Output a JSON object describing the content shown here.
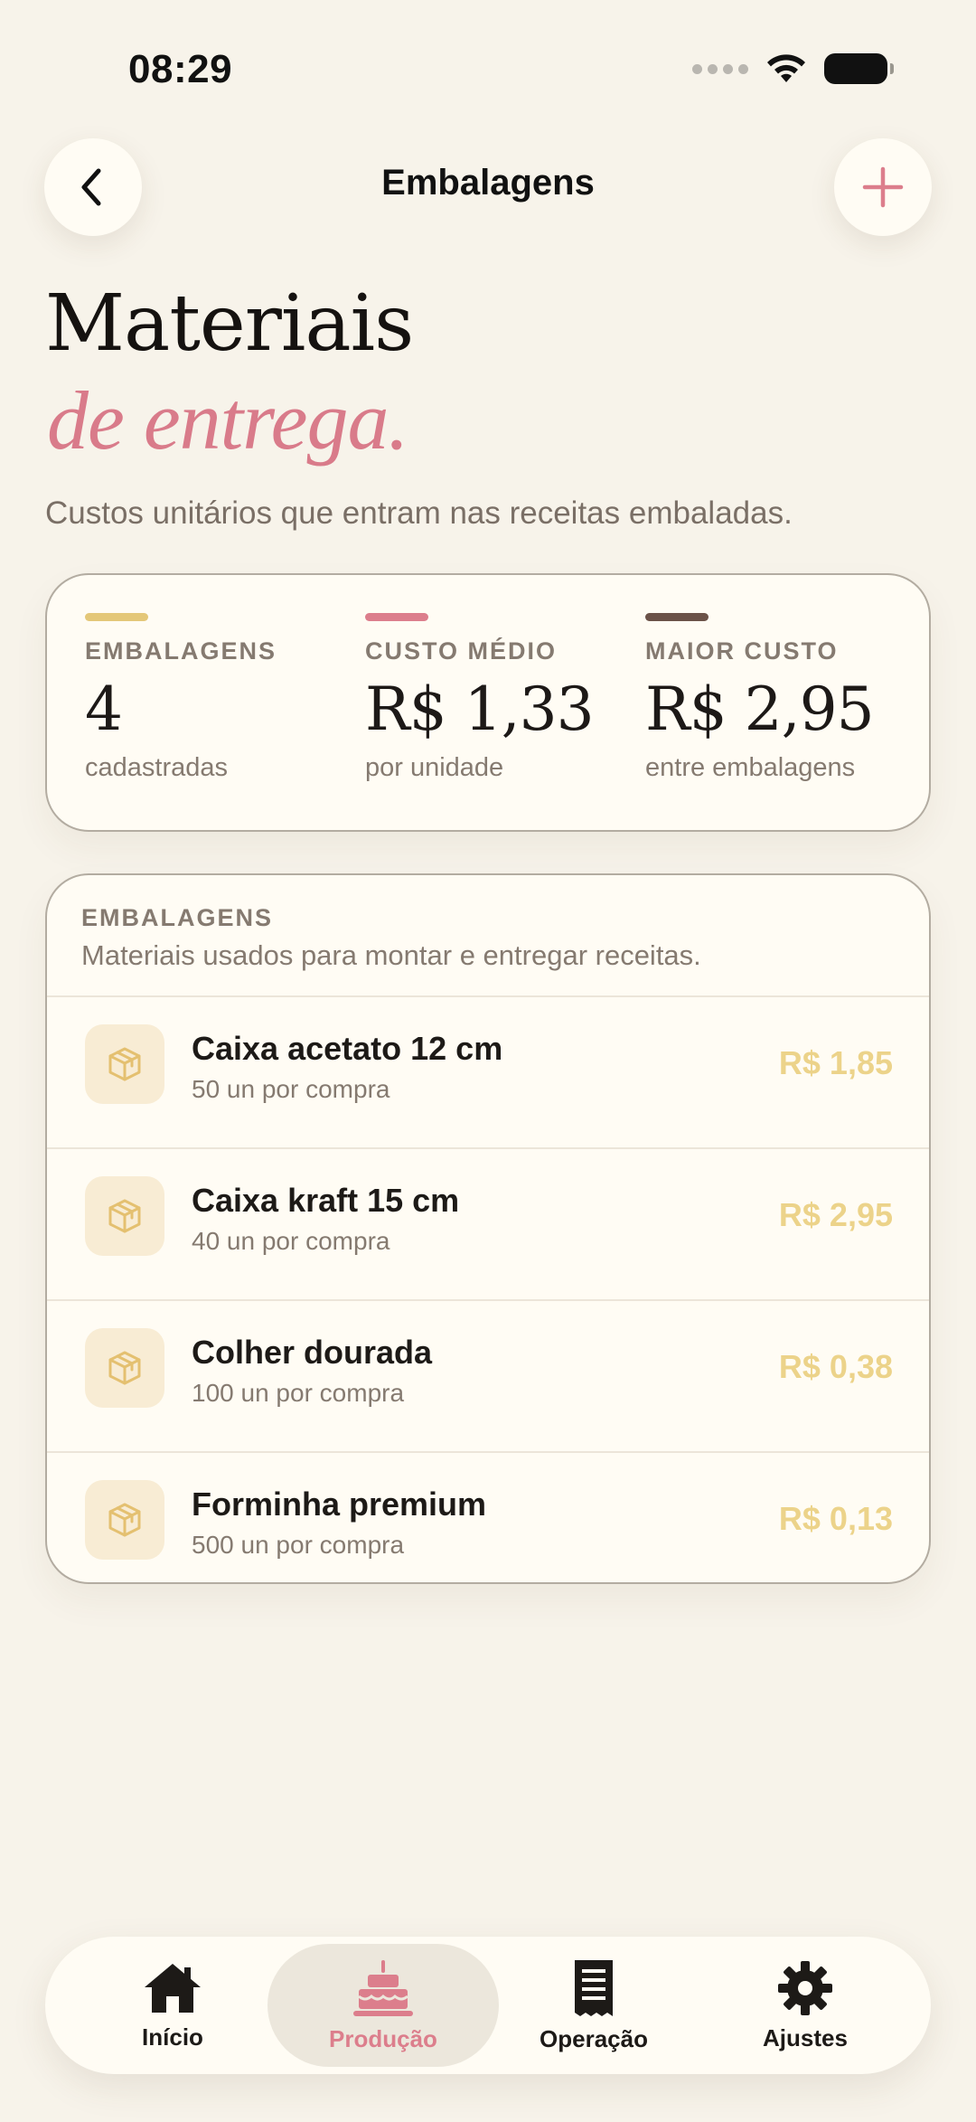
{
  "status_bar": {
    "time": "08:29"
  },
  "header": {
    "title": "Embalagens"
  },
  "hero": {
    "title": "Materiais",
    "subtitle": "de entrega.",
    "description": "Custos unitários que entram nas receitas embaladas."
  },
  "stats": [
    {
      "label": "EMBALAGENS",
      "value": "4",
      "caption": "cadastradas",
      "color": "#e4c778"
    },
    {
      "label": "CUSTO MÉDIO",
      "value": "R$ 1,33",
      "caption": "por unidade",
      "color": "#dc7e8c"
    },
    {
      "label": "MAIOR CUSTO",
      "value": "R$ 2,95",
      "caption": "entre embalagens",
      "color": "#6b5248"
    }
  ],
  "list": {
    "title": "EMBALAGENS",
    "description": "Materiais usados para montar e entregar receitas.",
    "items": [
      {
        "name": "Caixa acetato 12 cm",
        "sub": "50 un por compra",
        "price": "R$ 1,85",
        "icon": "box-icon"
      },
      {
        "name": "Caixa kraft 15 cm",
        "sub": "40 un por compra",
        "price": "R$ 2,95",
        "icon": "box-icon"
      },
      {
        "name": "Colher dourada",
        "sub": "100 un por compra",
        "price": "R$ 0,38",
        "icon": "box-icon"
      },
      {
        "name": "Forminha premium",
        "sub": "500 un por compra",
        "price": "R$ 0,13",
        "icon": "box-icon"
      }
    ]
  },
  "tabs": [
    {
      "label": "Início",
      "icon": "home-icon",
      "active": false
    },
    {
      "label": "Produção",
      "icon": "cake-icon",
      "active": true
    },
    {
      "label": "Operação",
      "icon": "receipt-icon",
      "active": false
    },
    {
      "label": "Ajustes",
      "icon": "gear-icon",
      "active": false
    }
  ],
  "colors": {
    "accent": "#dc7e8c",
    "gold": "#ecd38a",
    "background": "#f7f3ea"
  }
}
